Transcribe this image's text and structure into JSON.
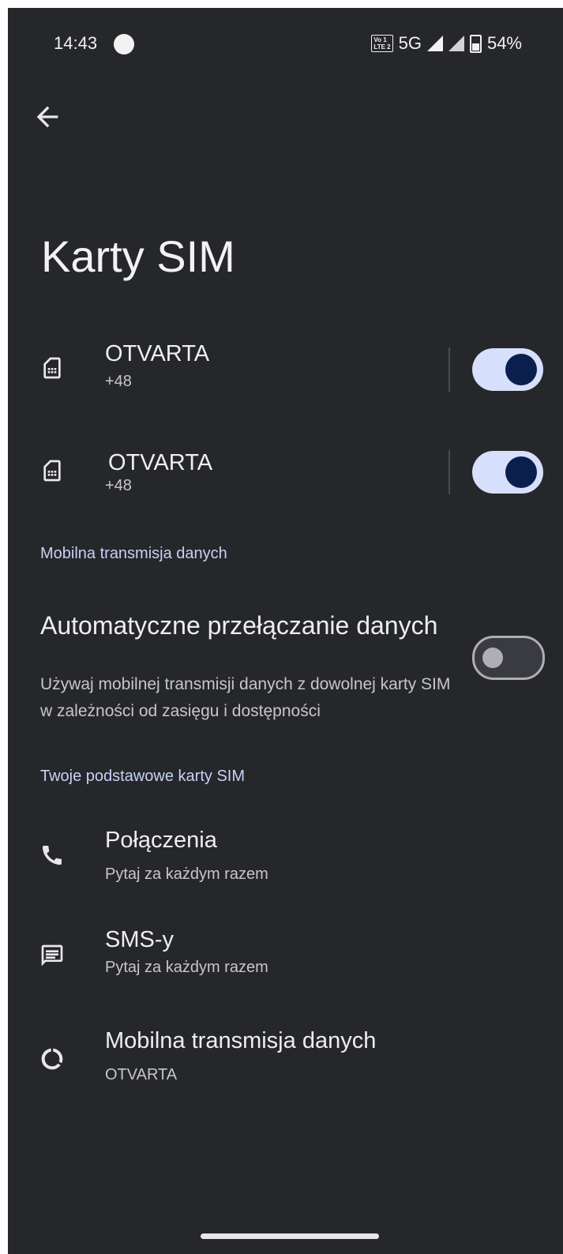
{
  "status_bar": {
    "time": "14:43",
    "volte_line1": "Vo 1",
    "volte_line2": "LTE 2",
    "network": "5G",
    "battery": "54%"
  },
  "page": {
    "title": "Karty SIM"
  },
  "sims": [
    {
      "name": "OTVARTA",
      "number": "+48",
      "enabled": true
    },
    {
      "name": "OTVARTA",
      "number": "+48",
      "enabled": true
    }
  ],
  "mobile_data_section": {
    "header": "Mobilna transmisja danych",
    "auto_switch_title": "Automatyczne przełączanie danych",
    "auto_switch_summary": "Używaj mobilnej transmisji danych z dowolnej karty SIM w zależności od zasięgu i dostępności",
    "auto_switch_enabled": false
  },
  "primary_section": {
    "header": "Twoje podstawowe karty SIM",
    "calls_title": "Połączenia",
    "calls_value": "Pytaj za każdym razem",
    "sms_title": "SMS-y",
    "sms_value": "Pytaj za każdym razem",
    "data_title": "Mobilna transmisja danych",
    "data_value": "OTVARTA"
  },
  "colors": {
    "background": "#26272b",
    "accent": "#c6d2f5",
    "toggle_track_on": "#d6dffb",
    "toggle_knob_on": "#0a1f4e"
  },
  "icons": [
    "back-arrow-icon",
    "sim-card-icon",
    "phone-icon",
    "message-icon",
    "data-circle-icon"
  ]
}
